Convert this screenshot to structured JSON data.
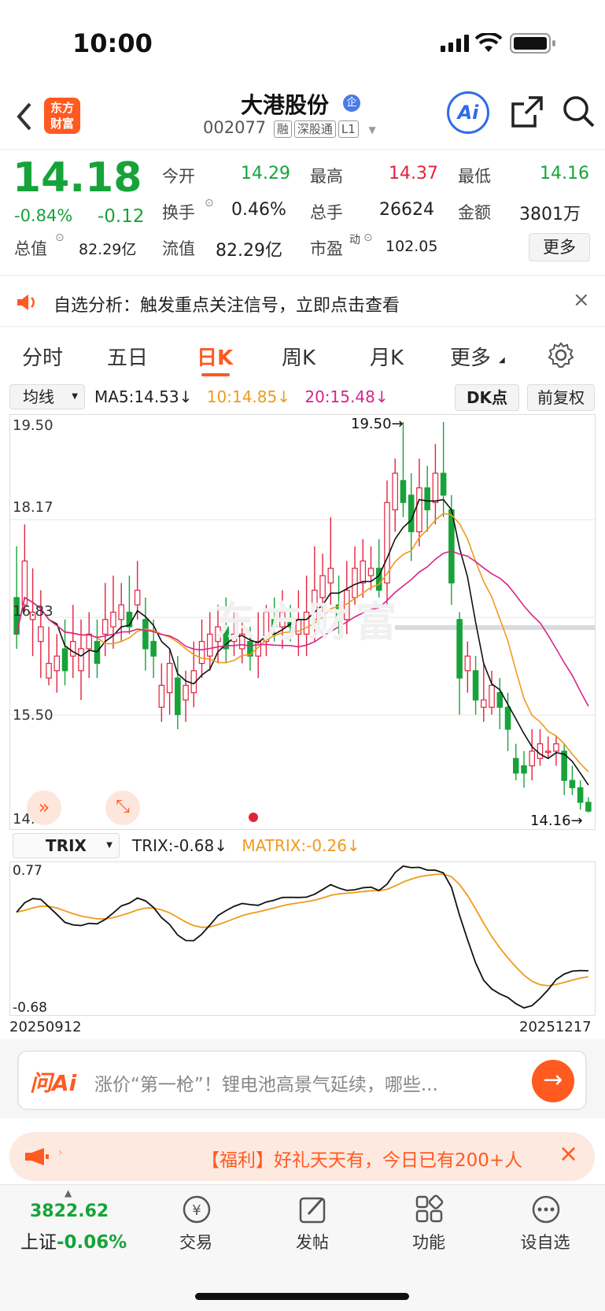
{
  "status": {
    "time": "10:00"
  },
  "header": {
    "logo_line1": "东方",
    "logo_line2": "财富",
    "stock_name": "大港股份",
    "badge": "企",
    "code": "002077",
    "tags": [
      "融",
      "深股通",
      "L1"
    ],
    "ai_label": "Ai"
  },
  "quote": {
    "price": "14.18",
    "change_pct": "-0.84%",
    "change": "-0.12",
    "open_label": "今开",
    "open": "14.29",
    "high_label": "最高",
    "high": "14.37",
    "low_label": "最低",
    "low": "14.16",
    "turnover_label": "换手",
    "turnover": "0.46%",
    "volume_label": "总手",
    "volume": "26624",
    "amount_label": "金额",
    "amount": "3801万",
    "mktcap_label": "总值",
    "mktcap": "82.29亿",
    "float_label": "流值",
    "float": "82.29亿",
    "pe_label": "市盈",
    "pe_sup": "动",
    "pe": "102.05",
    "more_button": "更多"
  },
  "notice": {
    "text": "自选分析：触发重点关注信号，立即点击查看"
  },
  "tabs": [
    "分时",
    "五日",
    "日K",
    "周K",
    "月K",
    "更多"
  ],
  "active_tab": "日K",
  "toolbar": {
    "indicator_select": "均线",
    "ma5": "MA5:14.53",
    "ma10": "10:14.85",
    "ma20": "20:15.48",
    "dk_button": "DK点",
    "fq_button": "前复权"
  },
  "chart": {
    "y_labels": [
      "19.50",
      "18.17",
      "16.83",
      "15.50",
      "14.16"
    ],
    "high_marker": "19.50",
    "low_marker": "14.16",
    "watermark": "东方财富"
  },
  "trix": {
    "select": "TRIX",
    "trix": "TRIX:-0.68",
    "matrix": "MATRIX:-0.26",
    "y_top": "0.77",
    "y_bottom": "-0.68",
    "date_start": "20250912",
    "date_end": "20251217"
  },
  "ask": {
    "brand": "问Ai",
    "text": "涨价“第一枪”！锂电池高景气延续，哪些..."
  },
  "promo": {
    "text": "【福利】好礼天天有，今日已有200+人"
  },
  "bottom_nav": {
    "index_value": "3822.62",
    "index_label": "上证",
    "index_change": "-0.06%",
    "items": [
      "交易",
      "发帖",
      "功能",
      "设自选"
    ]
  },
  "colors": {
    "up": "#e2233e",
    "down": "#17a33a",
    "ma10": "#f09a1a",
    "ma20": "#d6268a",
    "accent": "#ff6a1a"
  },
  "chart_data": {
    "type": "candlestick",
    "ylim": [
      14.16,
      19.5
    ],
    "candles": [
      [
        17.1,
        16.6,
        17.8,
        16.4
      ],
      [
        17.0,
        17.6,
        18.1,
        16.9
      ],
      [
        16.8,
        16.9,
        17.5,
        16.3
      ],
      [
        16.5,
        16.7,
        17.2,
        16.0
      ],
      [
        16.0,
        16.2,
        16.7,
        15.9
      ],
      [
        16.1,
        16.3,
        16.6,
        15.8
      ],
      [
        16.4,
        16.1,
        16.8,
        15.9
      ],
      [
        16.3,
        16.5,
        17.0,
        16.0
      ],
      [
        16.1,
        16.4,
        16.8,
        15.7
      ],
      [
        16.4,
        16.6,
        16.9,
        16.0
      ],
      [
        16.5,
        16.2,
        16.8,
        16.0
      ],
      [
        16.6,
        16.8,
        17.3,
        16.3
      ],
      [
        16.7,
        16.9,
        17.4,
        16.4
      ],
      [
        16.8,
        17.0,
        17.3,
        16.5
      ],
      [
        16.9,
        16.7,
        17.4,
        16.6
      ],
      [
        17.0,
        17.2,
        17.6,
        16.8
      ],
      [
        16.8,
        16.4,
        17.1,
        16.1
      ],
      [
        16.5,
        16.3,
        16.8,
        16.0
      ],
      [
        15.6,
        15.9,
        16.2,
        15.4
      ],
      [
        15.8,
        16.2,
        16.4,
        15.5
      ],
      [
        16.0,
        15.5,
        16.3,
        15.3
      ],
      [
        15.7,
        15.9,
        16.1,
        15.4
      ],
      [
        15.8,
        16.1,
        16.5,
        15.6
      ],
      [
        16.2,
        16.5,
        16.8,
        16.0
      ],
      [
        16.3,
        16.6,
        16.9,
        16.1
      ],
      [
        16.5,
        16.7,
        17.0,
        16.2
      ],
      [
        16.7,
        16.4,
        17.1,
        16.2
      ],
      [
        16.5,
        16.6,
        16.9,
        16.3
      ],
      [
        16.4,
        16.6,
        16.8,
        16.2
      ],
      [
        16.5,
        16.3,
        16.7,
        16.1
      ],
      [
        16.3,
        16.5,
        16.9,
        16.0
      ],
      [
        16.5,
        16.9,
        17.0,
        16.3
      ],
      [
        16.8,
        16.7,
        17.1,
        16.5
      ],
      [
        16.7,
        16.9,
        17.2,
        16.4
      ],
      [
        16.8,
        16.7,
        17.0,
        16.5
      ],
      [
        16.6,
        16.8,
        17.2,
        16.3
      ],
      [
        16.6,
        16.9,
        17.4,
        16.3
      ],
      [
        16.8,
        17.2,
        17.8,
        16.5
      ],
      [
        17.1,
        17.4,
        17.7,
        16.9
      ],
      [
        17.3,
        17.5,
        18.2,
        17.0
      ],
      [
        17.0,
        16.8,
        17.4,
        16.6
      ],
      [
        16.8,
        17.2,
        17.6,
        16.6
      ],
      [
        17.1,
        17.5,
        17.8,
        17.0
      ],
      [
        17.3,
        17.6,
        17.9,
        17.1
      ],
      [
        17.4,
        17.5,
        17.8,
        17.2
      ],
      [
        17.5,
        17.2,
        17.9,
        17.1
      ],
      [
        17.3,
        18.4,
        18.7,
        17.0
      ],
      [
        18.3,
        18.8,
        19.0,
        18.0
      ],
      [
        18.7,
        18.4,
        19.5,
        18.2
      ],
      [
        18.5,
        18.0,
        18.8,
        17.6
      ],
      [
        18.0,
        18.6,
        19.0,
        17.8
      ],
      [
        18.6,
        18.3,
        18.9,
        18.0
      ],
      [
        18.4,
        18.8,
        19.2,
        18.1
      ],
      [
        18.8,
        18.5,
        19.5,
        18.2
      ],
      [
        18.3,
        17.3,
        18.5,
        17.0
      ],
      [
        16.8,
        16.0,
        16.9,
        15.5
      ],
      [
        16.1,
        16.3,
        16.5,
        15.8
      ],
      [
        16.1,
        15.7,
        16.3,
        15.5
      ],
      [
        15.6,
        15.7,
        16.2,
        15.4
      ],
      [
        15.6,
        15.9,
        16.1,
        15.5
      ],
      [
        15.8,
        15.6,
        16.0,
        15.3
      ],
      [
        15.6,
        15.3,
        15.8,
        15.0
      ],
      [
        14.9,
        14.7,
        15.1,
        14.6
      ],
      [
        14.8,
        14.7,
        15.0,
        14.5
      ],
      [
        14.8,
        15.0,
        15.3,
        14.6
      ],
      [
        14.9,
        15.1,
        15.3,
        14.8
      ],
      [
        15.0,
        15.0,
        15.2,
        14.9
      ],
      [
        15.0,
        15.1,
        15.2,
        14.8
      ],
      [
        15.0,
        14.6,
        15.1,
        14.4
      ],
      [
        14.6,
        14.5,
        14.8,
        14.4
      ],
      [
        14.5,
        14.3,
        14.6,
        14.2
      ],
      [
        14.3,
        14.18,
        14.37,
        14.16
      ]
    ]
  }
}
